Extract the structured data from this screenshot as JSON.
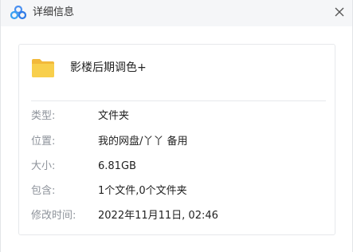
{
  "window": {
    "title": "详细信息"
  },
  "file": {
    "name": "影楼后期调色+"
  },
  "properties": [
    {
      "label": "类型:",
      "value": "文件夹"
    },
    {
      "label": "位置:",
      "value": "我的网盘/丫丫 备用"
    },
    {
      "label": "大小:",
      "value": "6.81GB"
    },
    {
      "label": "包含:",
      "value": "1个文件,0个文件夹"
    },
    {
      "label": "修改时间:",
      "value": "2022年11月11日, 02:46"
    }
  ],
  "icons": {
    "app_logo": "cloud-logo-icon",
    "close": "close-icon",
    "folder": "folder-icon"
  },
  "colors": {
    "folder_yellow": "#f8cf4c",
    "brand_blue": "#3b8cf5",
    "label_gray": "#8e939b"
  }
}
